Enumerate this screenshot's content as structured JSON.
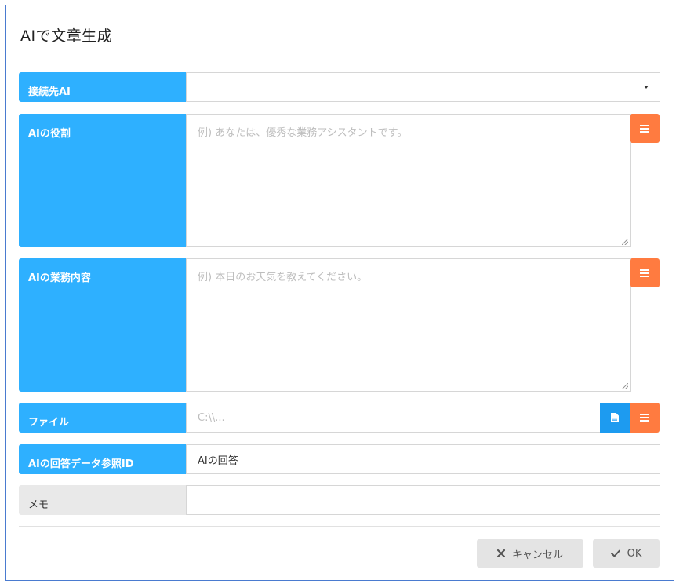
{
  "dialog": {
    "title": "AIで文章生成"
  },
  "fields": {
    "ai_connection": {
      "label": "接続先AI",
      "value": ""
    },
    "ai_role": {
      "label": "AIの役割",
      "placeholder": "例) あなたは、優秀な業務アシスタントです。"
    },
    "ai_task": {
      "label": "AIの業務内容",
      "placeholder": "例) 本日のお天気を教えてください。"
    },
    "file": {
      "label": "ファイル",
      "placeholder": "C:\\\\..."
    },
    "ai_answer_ref": {
      "label": "AIの回答データ参照ID",
      "value": "AIの回答"
    },
    "memo": {
      "label": "メモ",
      "value": ""
    }
  },
  "buttons": {
    "cancel": "キャンセル",
    "ok": "OK"
  },
  "colors": {
    "label_bg": "#2eb0ff",
    "menu_button": "#ff7b40",
    "file_button": "#1d9bf0",
    "label_gray": "#e9e9e9"
  },
  "icons": {
    "menu": "list-icon",
    "file": "document-icon",
    "cancel": "x-icon",
    "ok": "check-icon"
  }
}
